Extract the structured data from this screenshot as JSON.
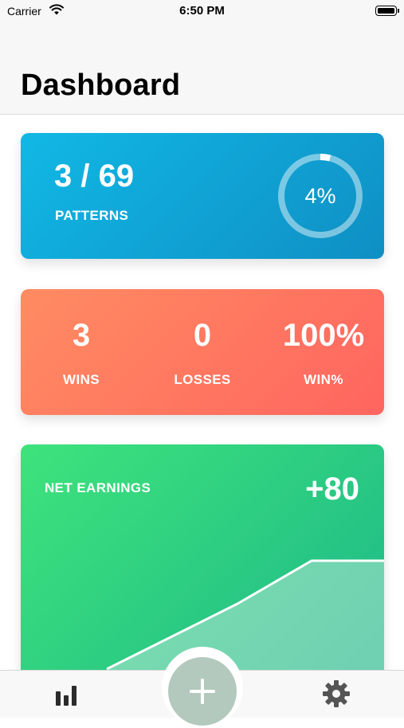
{
  "status_bar": {
    "carrier": "Carrier",
    "time": "6:50 PM"
  },
  "header": {
    "title": "Dashboard"
  },
  "patterns_card": {
    "count": "3 / 69",
    "label": "PATTERNS",
    "progress_text": "4%",
    "progress_fraction": 0.04
  },
  "record_card": {
    "stats": [
      {
        "value": "3",
        "label": "WINS"
      },
      {
        "value": "0",
        "label": "LOSSES"
      },
      {
        "value": "100%",
        "label": "WIN%"
      }
    ]
  },
  "earnings_card": {
    "label": "NET EARNINGS",
    "value": "+80"
  },
  "tab_bar": {
    "left_icon": "bar-chart-icon",
    "center_icon": "plus-icon",
    "right_icon": "gear-icon"
  },
  "colors": {
    "patterns_gradient": [
      "#11b8e5",
      "#0f8fc4"
    ],
    "record_gradient": [
      "#ff8c62",
      "#ff655f"
    ],
    "earnings_gradient": [
      "#3ee37b",
      "#1db889"
    ],
    "add_button": "#b3c9bd",
    "tab_icons": "#2b2b2b"
  }
}
